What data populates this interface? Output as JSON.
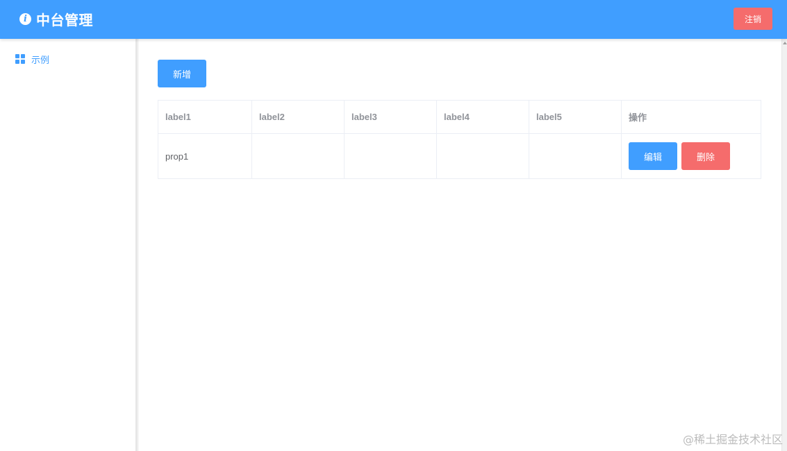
{
  "header": {
    "icon": "info-icon",
    "icon_glyph": "i",
    "title": "中台管理",
    "logout_label": "注销"
  },
  "sidebar": {
    "items": [
      {
        "icon": "grid-icon",
        "label": "示例"
      }
    ]
  },
  "main": {
    "add_label": "新增",
    "table": {
      "columns": [
        "label1",
        "label2",
        "label3",
        "label4",
        "label5",
        "操作"
      ],
      "rows": [
        {
          "cells": [
            "prop1",
            "",
            "",
            "",
            ""
          ],
          "edit_label": "编辑",
          "delete_label": "删除"
        }
      ]
    }
  },
  "watermark": "@稀土掘金技术社区",
  "colors": {
    "primary": "#409eff",
    "danger": "#f56c6c",
    "header_text": "#ffffff",
    "table_header_text": "#909399",
    "table_cell_text": "#606266"
  }
}
